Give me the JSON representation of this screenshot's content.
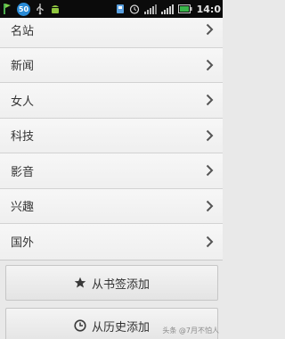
{
  "status_bar": {
    "badge": "50",
    "time": "14:0"
  },
  "categories": [
    {
      "label": "名站"
    },
    {
      "label": "新闻"
    },
    {
      "label": "女人"
    },
    {
      "label": "科技"
    },
    {
      "label": "影音"
    },
    {
      "label": "兴趣"
    },
    {
      "label": "国外"
    }
  ],
  "actions": {
    "add_from_bookmarks": "从书签添加",
    "add_from_history": "从历史添加"
  },
  "watermark": "头条 @7月不怕人",
  "colors": {
    "status_bar": "#0b0b0b",
    "background": "#e9e9e9",
    "row_text": "#333333"
  }
}
